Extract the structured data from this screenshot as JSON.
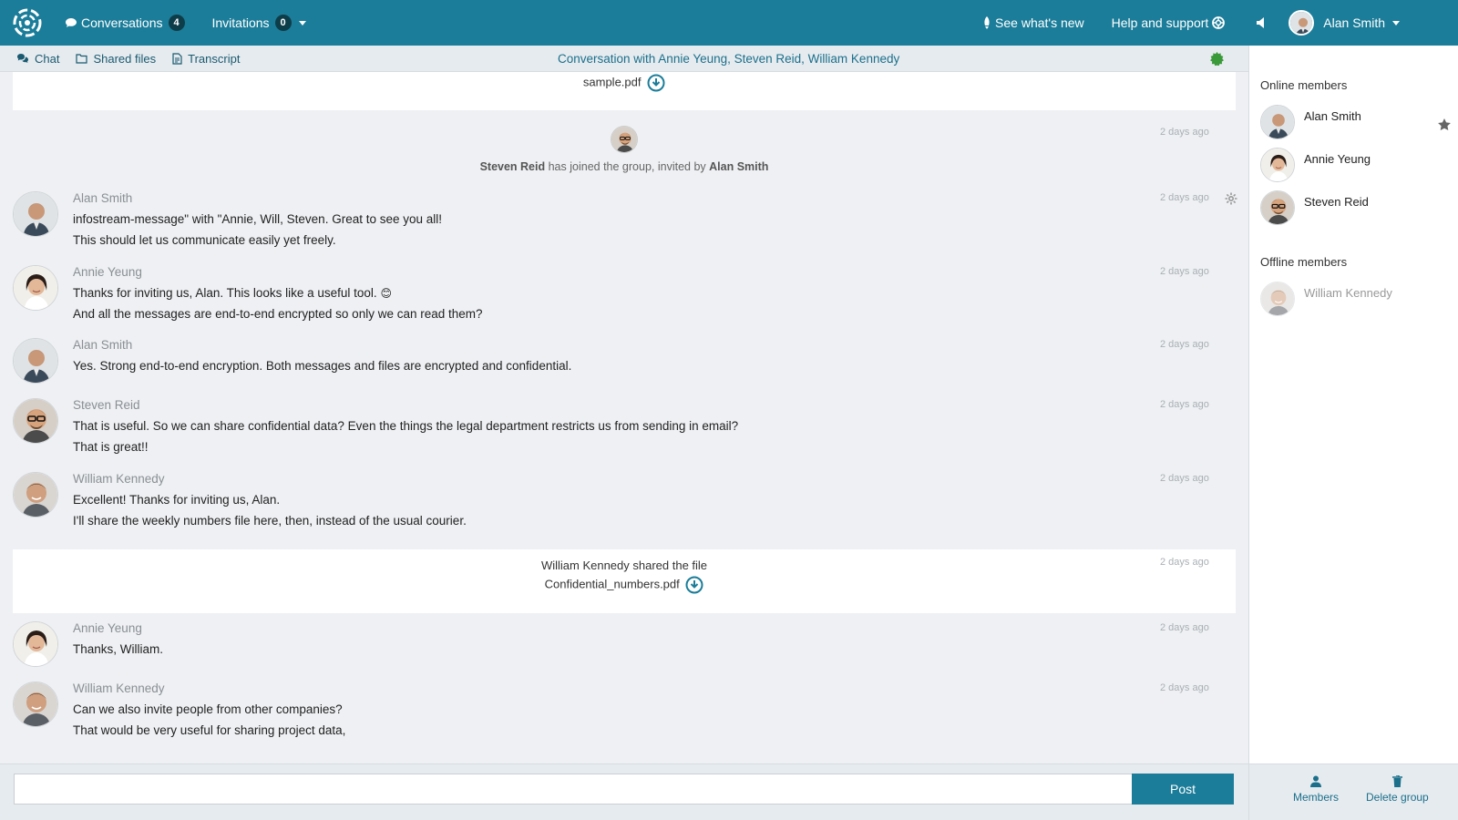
{
  "topbar": {
    "conversations_label": "Conversations",
    "conversations_count": "4",
    "invitations_label": "Invitations",
    "invitations_count": "0",
    "whats_new_label": "See what's new",
    "help_label": "Help and support",
    "user_name": "Alan Smith"
  },
  "subbar": {
    "tabs": [
      {
        "label": "Chat"
      },
      {
        "label": "Shared files"
      },
      {
        "label": "Transcript"
      }
    ],
    "conversation_title": "Conversation with Annie Yeung, Steven Reid, William Kennedy",
    "status_color": "#3a9a3a"
  },
  "chat": {
    "top_file": "sample.pdf",
    "join_event": {
      "person": "Steven Reid",
      "middle": "has joined the group, invited by",
      "inviter": "Alan Smith",
      "time": "2 days ago"
    },
    "messages": [
      {
        "name": "Alan Smith",
        "line1": "infostream-message\" with \"Annie, Will, Steven. Great to see you all!",
        "line2": "This should let us communicate easily yet freely.",
        "time": "2 days ago"
      },
      {
        "name": "Annie Yeung",
        "line1": "Thanks for inviting us, Alan. This looks like a useful tool.",
        "line2": "And all the messages are end-to-end encrypted so only we can read them?",
        "time": "2 days ago"
      },
      {
        "name": "Alan Smith",
        "line1": "Yes. Strong end-to-end encryption. Both messages and files are encrypted and confidential.",
        "line2": "",
        "time": "2 days ago"
      },
      {
        "name": "Steven Reid",
        "line1": "That is useful. So we can share confidential data? Even the things the legal department restricts us from sending in email?",
        "line2": "That is great!!",
        "time": "2 days ago"
      },
      {
        "name": "William Kennedy",
        "line1": "Excellent! Thanks for inviting us, Alan.",
        "line2": "I'll share the weekly numbers file here, then, instead of the usual courier.",
        "time": "2 days ago"
      },
      {
        "name": "Annie Yeung",
        "line1": "Thanks, William.",
        "line2": "",
        "time": "2 days ago"
      },
      {
        "name": "William Kennedy",
        "line1": "Can we also invite people from other companies?",
        "line2": "That would be very useful for sharing project data,",
        "time": "2 days ago"
      }
    ],
    "shared_file": {
      "caption": "William Kennedy shared the file",
      "file": "Confidential_numbers.pdf",
      "time": "2 days ago"
    },
    "emoji": "😊"
  },
  "composer": {
    "placeholder": "",
    "post_label": "Post"
  },
  "sidebar": {
    "online_heading": "Online members",
    "online": [
      {
        "name": "Alan Smith"
      },
      {
        "name": "Annie Yeung"
      },
      {
        "name": "Steven Reid"
      }
    ],
    "offline_heading": "Offline members",
    "offline": [
      {
        "name": "William Kennedy"
      }
    ],
    "actions": [
      {
        "label": "Members",
        "icon": "user-icon"
      },
      {
        "label": "Delete group",
        "icon": "trash-icon"
      }
    ]
  },
  "colors": {
    "brand": "#1b7d99",
    "badge": "#0e3d4a",
    "status_online": "#3a9a3a"
  }
}
